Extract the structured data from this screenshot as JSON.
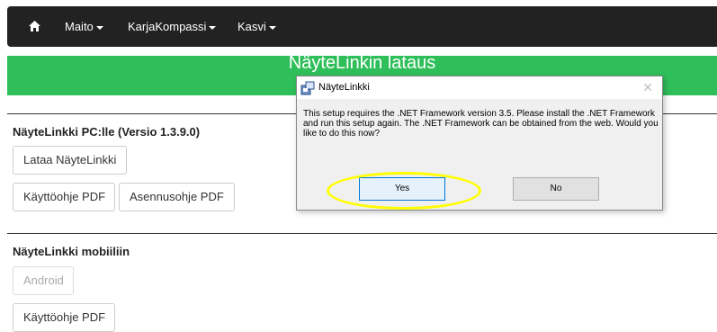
{
  "navbar": {
    "home_icon": "home-icon",
    "items": [
      {
        "label": "Maito"
      },
      {
        "label": "KarjaKompassi"
      },
      {
        "label": "Kasvi"
      }
    ]
  },
  "header": {
    "title": "NäyteLinkin lataus"
  },
  "pc_section": {
    "title": "NäyteLinkki PC:lle (Versio 1.3.9.0)",
    "download_label": "Lataa NäyteLinkki",
    "manual_label": "Käyttöohje PDF",
    "install_label": "Asennusohje PDF"
  },
  "mobile_section": {
    "title": "NäyteLinkki mobiiliin",
    "android_label": "Android",
    "manual_label": "Käyttöohje PDF"
  },
  "dialog": {
    "title": "NäyteLinkki",
    "message": "This setup requires the .NET Framework version 3.5.  Please install the .NET Framework and run this setup again.  The .NET Framework can be obtained from the web.  Would you like to do this now?",
    "yes_label": "Yes",
    "no_label": "No",
    "close_glyph": "✕"
  },
  "colors": {
    "navbar": "#222222",
    "header": "#2fbf5a",
    "highlight": "#ffff00",
    "yes_border": "#0078d7"
  }
}
